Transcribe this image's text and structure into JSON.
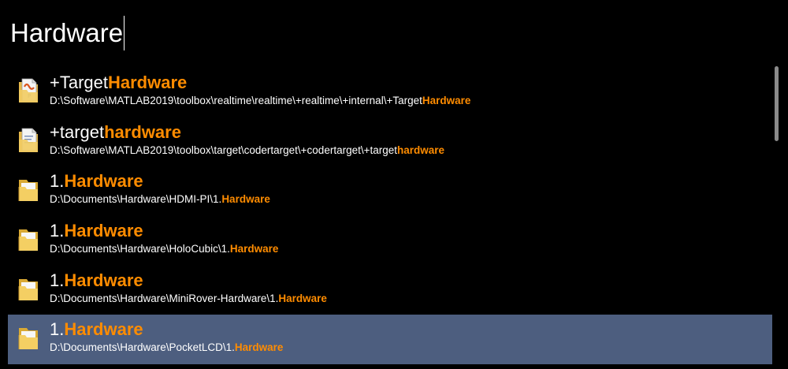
{
  "search": {
    "query": "Hardware"
  },
  "colors": {
    "background": "#000000",
    "highlight": "#ff8c00",
    "selected_row": "#4d5e7f",
    "text": "#ffffff"
  },
  "results": [
    {
      "icon": "matlab-file-icon",
      "title_prefix": "+Target",
      "title_match": "Hardware",
      "path_prefix": "D:\\Software\\MATLAB2019\\toolbox\\realtime\\realtime\\+realtime\\+internal\\+Target",
      "path_match": "Hardware",
      "selected": false
    },
    {
      "icon": "matlab-file-icon",
      "title_prefix": "+target",
      "title_match": "hardware",
      "path_prefix": "D:\\Software\\MATLAB2019\\toolbox\\target\\codertarget\\+codertarget\\+target",
      "path_match": "hardware",
      "selected": false
    },
    {
      "icon": "folder-icon",
      "title_prefix": "1.",
      "title_match": "Hardware",
      "path_prefix": "D:\\Documents\\Hardware\\HDMI-PI\\1.",
      "path_match": "Hardware",
      "selected": false
    },
    {
      "icon": "folder-icon",
      "title_prefix": "1.",
      "title_match": "Hardware",
      "path_prefix": "D:\\Documents\\Hardware\\HoloCubic\\1.",
      "path_match": "Hardware",
      "selected": false
    },
    {
      "icon": "folder-icon",
      "title_prefix": "1.",
      "title_match": "Hardware",
      "path_prefix": "D:\\Documents\\Hardware\\MiniRover-Hardware\\1.",
      "path_match": "Hardware",
      "selected": false
    },
    {
      "icon": "folder-icon",
      "title_prefix": "1.",
      "title_match": "Hardware",
      "path_prefix": "D:\\Documents\\Hardware\\PocketLCD\\1.",
      "path_match": "Hardware",
      "selected": true
    }
  ]
}
